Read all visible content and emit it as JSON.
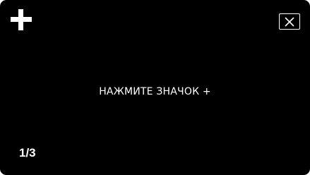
{
  "screen": {
    "background": "#000000",
    "foreground": "#ffffff"
  },
  "toolbar": {
    "add_icon": "plus-icon",
    "close_icon": "close-icon"
  },
  "main": {
    "instruction_text": "НАЖМИТЕ ЗНАЧОК +"
  },
  "footer": {
    "page_indicator": "1/3"
  }
}
